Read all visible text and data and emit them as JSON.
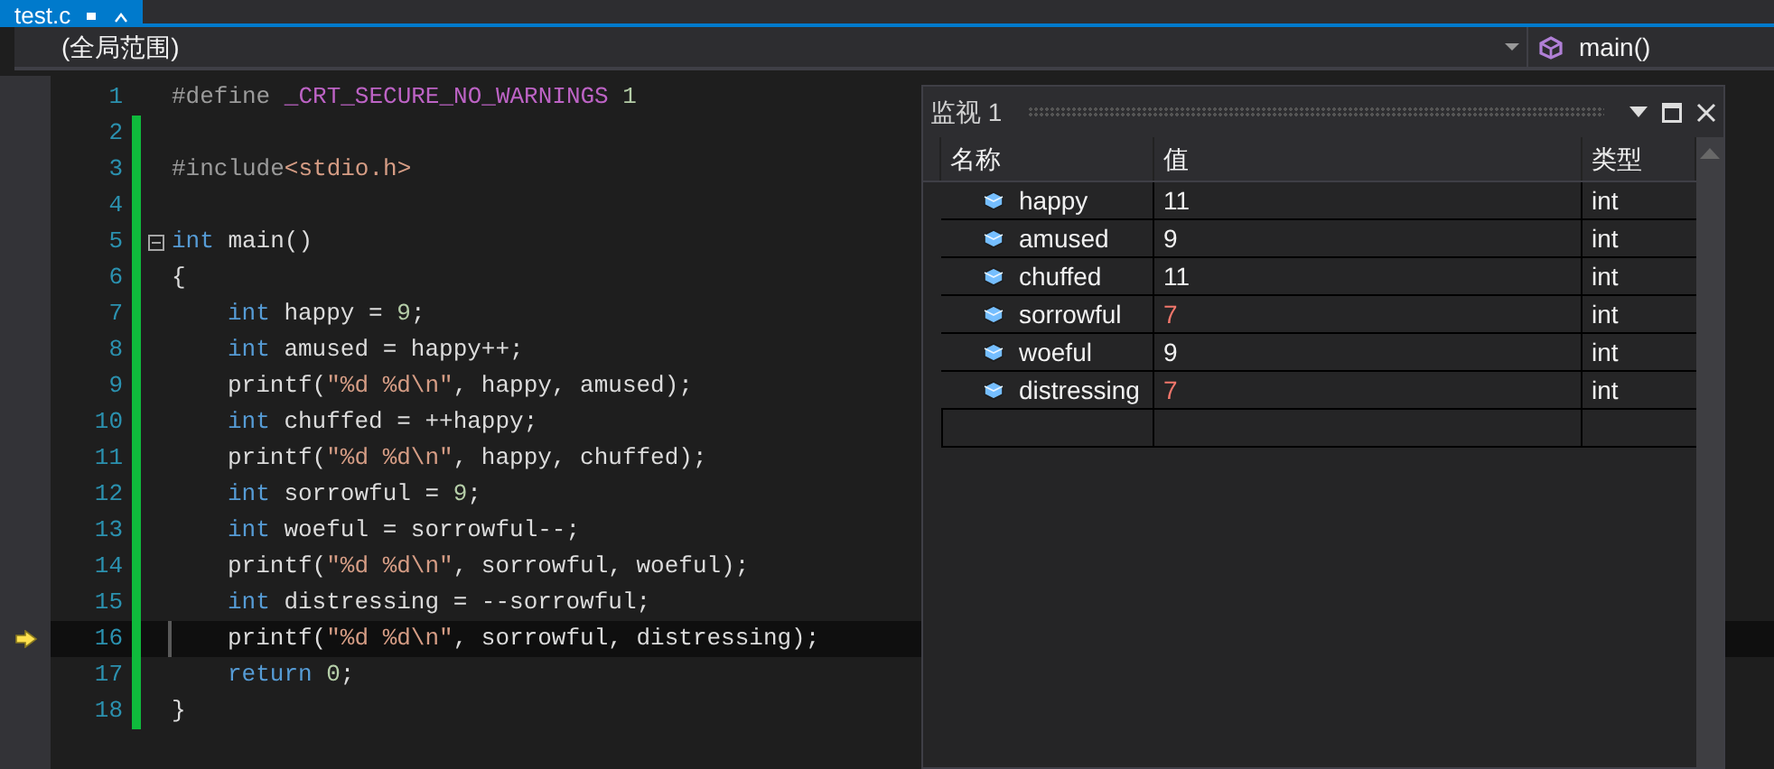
{
  "tab": {
    "title": "test.c",
    "selected": true
  },
  "nav": {
    "scope": "(全局范围)",
    "function": "main()"
  },
  "editor": {
    "lines": [
      {
        "number": "1",
        "changed": false,
        "current": false,
        "indented": false,
        "tokens": [
          {
            "kind": "preproc",
            "text": "#define "
          },
          {
            "kind": "macro",
            "text": "_CRT_SECURE_NO_WARNINGS"
          },
          {
            "kind": "number",
            "text": " 1"
          }
        ]
      },
      {
        "number": "2",
        "changed": true,
        "current": false
      },
      {
        "number": "3",
        "changed": true,
        "current": false,
        "indented": false,
        "tokens": [
          {
            "kind": "preproc",
            "text": "#include"
          },
          {
            "kind": "string",
            "text": "<stdio.h>"
          }
        ]
      },
      {
        "number": "4",
        "changed": true,
        "current": false
      },
      {
        "number": "5",
        "changed": true,
        "current": false,
        "fold": true,
        "indented": false,
        "tokens": [
          {
            "kind": "keyword",
            "text": "int"
          },
          {
            "kind": "plain",
            "text": " main()"
          }
        ]
      },
      {
        "number": "6",
        "changed": true,
        "current": false,
        "indented": false,
        "tokens": [
          {
            "kind": "plain",
            "text": "{"
          }
        ]
      },
      {
        "number": "7",
        "changed": true,
        "current": false,
        "indented": true,
        "tokens": [
          {
            "kind": "keyword",
            "text": "int"
          },
          {
            "kind": "plain",
            "text": " happy = "
          },
          {
            "kind": "number",
            "text": "9"
          },
          {
            "kind": "plain",
            "text": ";"
          }
        ]
      },
      {
        "number": "8",
        "changed": true,
        "current": false,
        "indented": true,
        "tokens": [
          {
            "kind": "keyword",
            "text": "int"
          },
          {
            "kind": "plain",
            "text": " amused = happy++;"
          }
        ]
      },
      {
        "number": "9",
        "changed": true,
        "current": false,
        "indented": true,
        "tokens": [
          {
            "kind": "plain",
            "text": "printf("
          },
          {
            "kind": "string",
            "text": "\"%d %d\\n\""
          },
          {
            "kind": "plain",
            "text": ", happy, amused);"
          }
        ]
      },
      {
        "number": "10",
        "changed": true,
        "current": false,
        "indented": true,
        "tokens": [
          {
            "kind": "keyword",
            "text": "int"
          },
          {
            "kind": "plain",
            "text": " chuffed = ++happy;"
          }
        ]
      },
      {
        "number": "11",
        "changed": true,
        "current": false,
        "indented": true,
        "tokens": [
          {
            "kind": "plain",
            "text": "printf("
          },
          {
            "kind": "string",
            "text": "\"%d %d\\n\""
          },
          {
            "kind": "plain",
            "text": ", happy, chuffed);"
          }
        ]
      },
      {
        "number": "12",
        "changed": true,
        "current": false,
        "indented": true,
        "tokens": [
          {
            "kind": "keyword",
            "text": "int"
          },
          {
            "kind": "plain",
            "text": " sorrowful = "
          },
          {
            "kind": "number",
            "text": "9"
          },
          {
            "kind": "plain",
            "text": ";"
          }
        ]
      },
      {
        "number": "13",
        "changed": true,
        "current": false,
        "indented": true,
        "tokens": [
          {
            "kind": "keyword",
            "text": "int"
          },
          {
            "kind": "plain",
            "text": " woeful = sorrowful--;"
          }
        ]
      },
      {
        "number": "14",
        "changed": true,
        "current": false,
        "indented": true,
        "tokens": [
          {
            "kind": "plain",
            "text": "printf("
          },
          {
            "kind": "string",
            "text": "\"%d %d\\n\""
          },
          {
            "kind": "plain",
            "text": ", sorrowful, woeful);"
          }
        ]
      },
      {
        "number": "15",
        "changed": true,
        "current": false,
        "indented": true,
        "tokens": [
          {
            "kind": "keyword",
            "text": "int"
          },
          {
            "kind": "plain",
            "text": " distressing = --sorrowful;"
          }
        ]
      },
      {
        "number": "16",
        "changed": true,
        "current": true,
        "indented": true,
        "tokens": [
          {
            "kind": "plain",
            "text": "printf("
          },
          {
            "kind": "string",
            "text": "\"%d %d\\n\""
          },
          {
            "kind": "plain",
            "text": ", sorrowful, distressing);"
          }
        ]
      },
      {
        "number": "17",
        "changed": true,
        "current": false,
        "indented": true,
        "tokens": [
          {
            "kind": "keyword",
            "text": "return"
          },
          {
            "kind": "number",
            "text": " 0"
          },
          {
            "kind": "plain",
            "text": ";"
          }
        ]
      },
      {
        "number": "18",
        "changed": true,
        "current": false,
        "indented": false,
        "tokens": [
          {
            "kind": "plain",
            "text": "}"
          }
        ]
      }
    ]
  },
  "watch": {
    "title": "监视 1",
    "columns": [
      "名称",
      "值",
      "类型"
    ],
    "rows": [
      {
        "name": "happy",
        "value": "11",
        "type": "int",
        "changed": false
      },
      {
        "name": "amused",
        "value": "9",
        "type": "int",
        "changed": false
      },
      {
        "name": "chuffed",
        "value": "11",
        "type": "int",
        "changed": false
      },
      {
        "name": "sorrowful",
        "value": "7",
        "type": "int",
        "changed": true
      },
      {
        "name": "woeful",
        "value": "9",
        "type": "int",
        "changed": false
      },
      {
        "name": "distressing",
        "value": "7",
        "type": "int",
        "changed": true
      }
    ]
  }
}
